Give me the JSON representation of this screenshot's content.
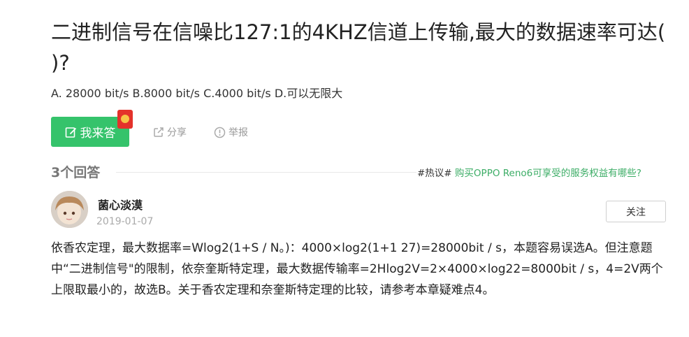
{
  "question": {
    "title": "二进制信号在信噪比127:1的4KHZ信道上传输,最大的数据速率可达( )?",
    "options": "A. 28000 bit/s B.8000 bit/s C.4000 bit/s D.可以无限大"
  },
  "actions": {
    "answer_label": "我来答",
    "share_label": "分享",
    "report_label": "举报"
  },
  "answers": {
    "count_label": "3个回答"
  },
  "hot_topic": {
    "tag": "#热议#",
    "link": "购买OPPO Reno6可享受的服务权益有哪些?"
  },
  "answer": {
    "username": "菌心淡漠",
    "date": "2019-01-07",
    "follow_label": "关注",
    "text": "依香农定理，最大数据率=Wlog2(1+S / N。)：4000×log2(1+1 27)=28000bit / s，本题容易误选A。但注意题中“二进制信号\"的限制，依奈奎斯特定理，最大数据传输率=2Hlog2V=2×4000×log22=8000bit / s，4=2V两个上限取最小的，故选B。关于香农定理和奈奎斯特定理的比较，请参考本章疑难点4。"
  },
  "colors": {
    "accent_green": "#35c36b",
    "link_green": "#3cad66",
    "redpacket": "#e4322b"
  }
}
